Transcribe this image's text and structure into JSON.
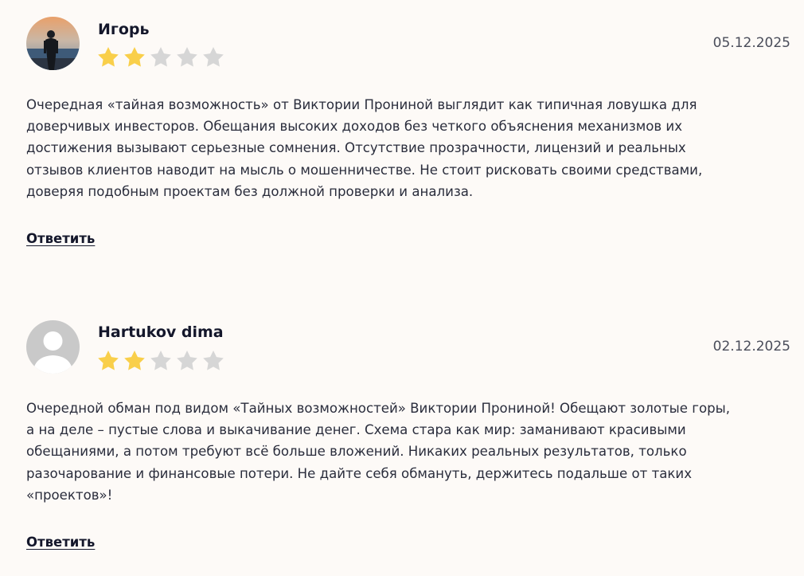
{
  "reviews": [
    {
      "author": "Игорь",
      "date": "05.12.2025",
      "rating": 2,
      "max_rating": 5,
      "avatar": "user-photo-icon",
      "text": "Очередная «тайная возможность» от Виктории Прониной выглядит как типичная ловушка для\nдоверчивых инвесторов. Обещания высоких доходов без четкого объяснения механизмов их\nдостижения вызывают серьезные сомнения. Отсутствие прозрачности, лицензий и реальных\nотзывов клиентов наводит на мысль о мошенничестве. Не стоит рисковать своими средствами,\nдоверяя подобным проектам без должной проверки и анализа.",
      "reply_label": "Ответить"
    },
    {
      "author": "Hartukov dima",
      "date": "02.12.2025",
      "rating": 2,
      "max_rating": 5,
      "avatar": "default-avatar-icon",
      "text": "Очередной обман под видом «Тайных возможностей» Виктории Прониной! Обещают золотые горы,\nа на деле – пустые слова и выкачивание денег. Схема стара как мир: заманивают красивыми\nобещаниями, а потом требуют всё больше вложений. Никаких реальных результатов, только\nразочарование и финансовые потери. Не дайте себя обмануть, держитесь подальше от таких\n«проектов»!",
      "reply_label": "Ответить"
    }
  ],
  "colors": {
    "star_filled": "#f9cf4a",
    "star_empty": "#d6d6d6",
    "background": "#fdfaf7"
  }
}
